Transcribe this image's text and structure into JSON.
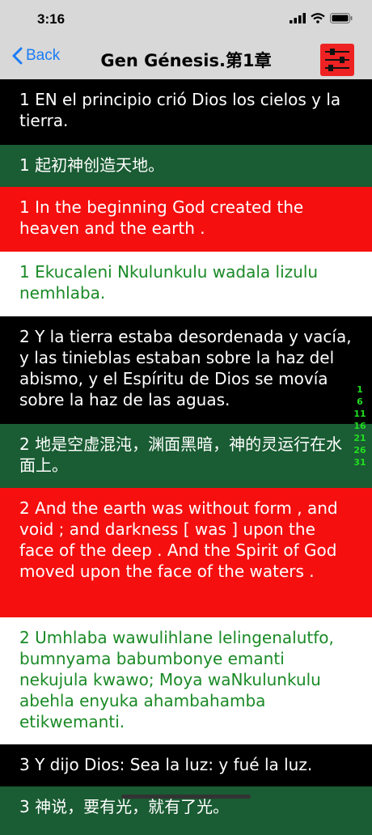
{
  "status": {
    "time": "3:16"
  },
  "nav": {
    "back_label": "Back",
    "title": "Gen Génesis.第1章"
  },
  "colors": {
    "accent": "#1a7cf5",
    "spanish_bg": "#000000",
    "chinese_bg": "#1a5c33",
    "english_bg": "#f50f0f",
    "zulu_bg": "#ffffff",
    "zulu_text": "#1a8a26",
    "index_text": "#22dd22"
  },
  "verses": [
    {
      "lang": "es",
      "text": "1 EN el principio crió Dios los cielos y la tierra."
    },
    {
      "lang": "zh",
      "text": "1 起初神创造天地。"
    },
    {
      "lang": "en",
      "text": "1 In the beginning God created the heaven and the earth ."
    },
    {
      "lang": "zu",
      "text": "1 Ekucaleni Nkulunkulu wadala lizulu nemhlaba."
    },
    {
      "lang": "es",
      "text": "2 Y la tierra estaba desordenada y vacía, y las tinieblas estaban sobre la haz del abismo, y el Espíritu de Dios se movía sobre la haz de las aguas."
    },
    {
      "lang": "zh",
      "text": "2 地是空虚混沌，渊面黑暗，神的灵运行在水面上。"
    },
    {
      "lang": "en",
      "text": "2 And the earth was without form , and void ; and darkness [ was ] upon the face of the deep . And the Spirit of God moved upon the face of the waters ."
    },
    {
      "lang": "zu",
      "text": "2 Umhlaba wawulihlane lelingenalutfo, bumnyama babumbonye emanti nekujula kwawo; Moya waNkulunkulu abehla enyuka ahambahamba etikwemanti."
    },
    {
      "lang": "es",
      "text": "3 Y dijo Dios: Sea la luz: y fué la luz."
    },
    {
      "lang": "zh",
      "text": "3 神说，要有光，就有了光。"
    }
  ],
  "index": [
    "1",
    "6",
    "11",
    "16",
    "21",
    "26",
    "31"
  ]
}
